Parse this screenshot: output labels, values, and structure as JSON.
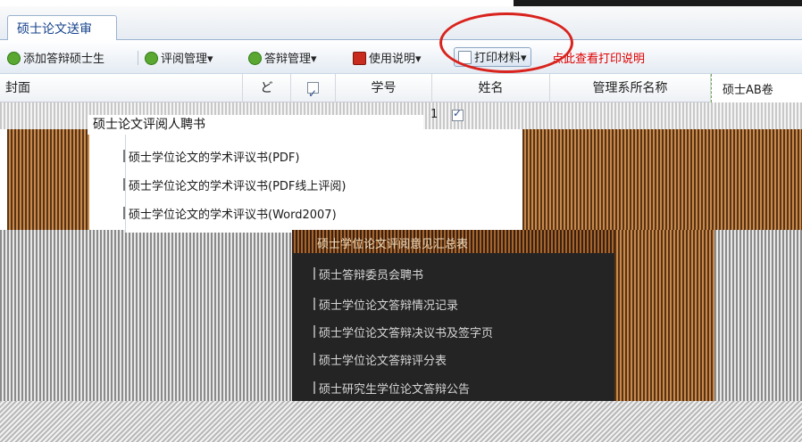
{
  "window": {
    "tab_title": "硕士论文送审"
  },
  "toolbar": {
    "add_label": "添加答辩硕士生",
    "review_label": "评阅管理",
    "defense_label": "答辩管理",
    "manual_label": "使用说明",
    "print_label": "打印材料",
    "print_hint": "点此查看打印说明"
  },
  "grid": {
    "columns": {
      "cover": "封面",
      "narrow": "ど",
      "student_id": "学号",
      "name": "姓名",
      "dept": "管理系所名称"
    },
    "right_tab": "硕士AB卷",
    "row1_number": "1"
  },
  "print_menu_light": {
    "title": "硕士论文评阅人聘书",
    "items": [
      "硕士学位论文的学术评议书(PDF)",
      "硕士学位论文的学术评议书(PDF线上评阅)",
      "硕士学位论文的学术评议书(Word2007)"
    ]
  },
  "print_menu_dark": {
    "head": "硕士学位论文评阅意见汇总表",
    "items": [
      "硕士答辩委员会聘书",
      "硕士学位论文答辩情况记录",
      "硕士学位论文答辩决议书及签字页",
      "硕士学位论文答辩评分表",
      "硕士研究生学位论文答辩公告"
    ]
  },
  "colors": {
    "accent": "#15428b",
    "highlight_ring": "#d9231d",
    "hint_text": "#e00000"
  }
}
